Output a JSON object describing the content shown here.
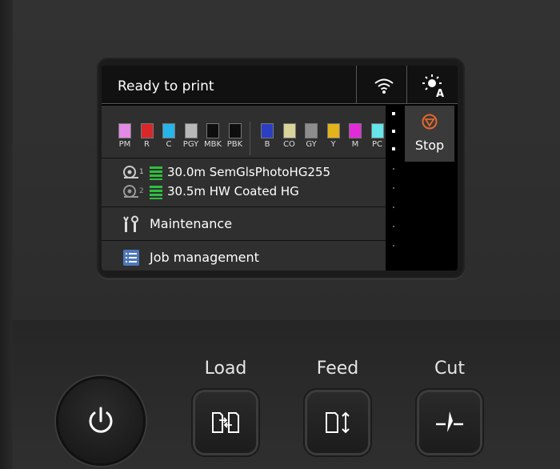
{
  "screen": {
    "status_text": "Ready to print",
    "icons": [
      "wifi-icon",
      "auto-brightness-icon"
    ],
    "inks": [
      {
        "label": "PM",
        "color": "#e38ae6"
      },
      {
        "label": "R",
        "color": "#d9272a"
      },
      {
        "label": "C",
        "color": "#27b4ea"
      },
      {
        "label": "PGY",
        "color": "#b8b8b8"
      },
      {
        "label": "MBK",
        "color": "#0e0e0e"
      },
      {
        "label": "PBK",
        "color": "#0e0e0e"
      },
      {
        "label": "B",
        "color": "#2b3fc4"
      },
      {
        "label": "CO",
        "color": "#d9d29a"
      },
      {
        "label": "GY",
        "color": "#8d8d8d"
      },
      {
        "label": "Y",
        "color": "#e3b31c"
      },
      {
        "label": "M",
        "color": "#e22bd8"
      },
      {
        "label": "PC",
        "color": "#63e5ea"
      }
    ],
    "rolls": [
      {
        "number": "1",
        "text": "30.0m  SemGlsPhotoHG255"
      },
      {
        "number": "2",
        "text": "30.5m  HW Coated HG"
      }
    ],
    "menu": [
      {
        "label": "Maintenance",
        "icon": "maintenance-tools-icon"
      },
      {
        "label": "Job management",
        "icon": "job-list-icon"
      }
    ],
    "stop_label": "Stop",
    "stop_color": "#e4682a"
  },
  "controls": {
    "load_label": "Load",
    "feed_label": "Feed",
    "cut_label": "Cut"
  }
}
